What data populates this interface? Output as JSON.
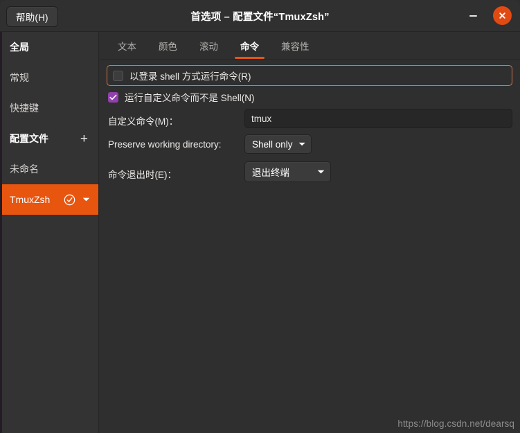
{
  "window": {
    "title": "首选项 – 配置文件“TmuxZsh”",
    "help_label": "帮助(H)",
    "minimize_icon": "minimize-icon",
    "close_icon": "close-icon",
    "accent_color": "#e8550f",
    "close_button_color": "#e24a12",
    "checkbox_checked_color": "#9141ac",
    "focus_ring_color": "#d2794e"
  },
  "sidebar": {
    "items": [
      {
        "label": "全局",
        "type": "header",
        "selected": false
      },
      {
        "label": "常规",
        "type": "item",
        "selected": false
      },
      {
        "label": "快捷键",
        "type": "item",
        "selected": false
      },
      {
        "label": "配置文件",
        "type": "header",
        "selected": false,
        "action_icon": "plus-icon",
        "action_label": "+"
      },
      {
        "label": "未命名",
        "type": "item",
        "selected": false
      },
      {
        "label": "TmuxZsh",
        "type": "item",
        "selected": true,
        "icons": [
          "check-circle-icon",
          "chevron-down-icon"
        ]
      }
    ]
  },
  "tabs": [
    {
      "label": "文本",
      "active": false
    },
    {
      "label": "颜色",
      "active": false
    },
    {
      "label": "滚动",
      "active": false
    },
    {
      "label": "命令",
      "active": true
    },
    {
      "label": "兼容性",
      "active": false
    }
  ],
  "panel": {
    "login_shell": {
      "label": "以登录 shell 方式运行命令(R)",
      "checked": false,
      "focused": true
    },
    "custom_command_toggle": {
      "label": "运行自定义命令而不是 Shell(N)",
      "checked": true
    },
    "custom_command": {
      "label": "自定义命令(M)：",
      "value": "tmux",
      "placeholder": ""
    },
    "preserve_directory": {
      "label": "Preserve working directory:",
      "value": "Shell only"
    },
    "exit_action": {
      "label": "命令退出时(E)：",
      "value": "退出终端"
    }
  },
  "watermark": {
    "text": "https://blog.csdn.net/dearsq"
  }
}
